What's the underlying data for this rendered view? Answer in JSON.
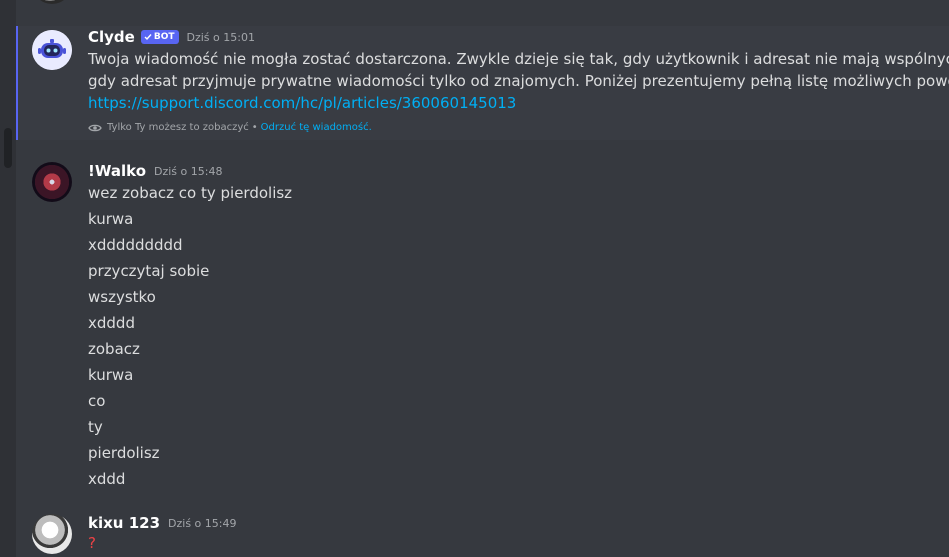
{
  "colors": {
    "background": "#36393f",
    "accent": "#5865f2",
    "link": "#00aff4",
    "danger": "#ed4245"
  },
  "clyde": {
    "username": "Clyde",
    "badge": "BOT",
    "timestamp": "Dziś o 15:01",
    "text_line1": "Twoja wiadomość nie mogła zostać dostarczona. Zwykle dzieje się tak, gdy użytkownik i adresat nie mają wspólnych serwerów, albo",
    "text_line2": "gdy adresat przyjmuje prywatne wiadomości tylko od znajomych. Poniżej prezentujemy pełną listę możliwych powodów:",
    "link": "https://support.discord.com/hc/pl/articles/360060145013",
    "ephemeral_note": "Tylko Ty możesz to zobaczyć",
    "dismiss": "Odrzuć tę wiadomość."
  },
  "walko": {
    "username": "!Walko",
    "timestamp": "Dziś o 15:48",
    "lines": [
      "wez zobacz co ty pierdolisz",
      "kurwa",
      "xddddddddd",
      "przyczytaj sobie",
      "wszystko",
      "xdddd",
      "zobacz",
      "kurwa",
      "co",
      "ty",
      "pierdolisz",
      "xddd"
    ]
  },
  "kixu": {
    "username": "kixu 123",
    "timestamp": "Dziś o 15:49",
    "text": "?"
  },
  "icons": {
    "bot_check": "checkmark-icon",
    "eye": "eye-icon"
  }
}
